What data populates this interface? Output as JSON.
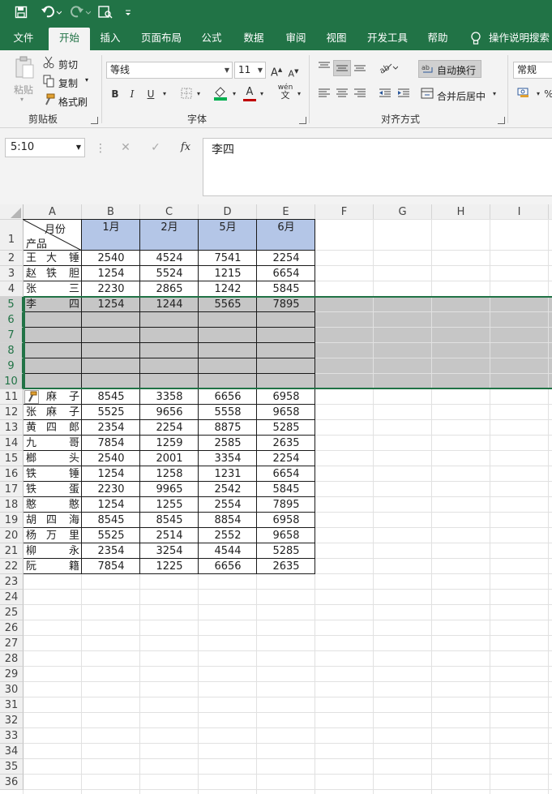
{
  "quick_access": {
    "save_icon": "save-icon",
    "undo_icon": "undo-icon",
    "redo_icon": "redo-icon",
    "preview_icon": "print-preview-icon",
    "more_icon": "customize-icon"
  },
  "tabs": [
    "文件",
    "开始",
    "插入",
    "页面布局",
    "公式",
    "数据",
    "审阅",
    "视图",
    "开发工具",
    "帮助"
  ],
  "tell_me": "操作说明搜索",
  "clipboard": {
    "paste": "粘贴",
    "cut": "剪切",
    "copy": "复制",
    "format_painter": "格式刷",
    "group": "剪贴板"
  },
  "font": {
    "name": "等线",
    "size": "11",
    "grow": "A",
    "shrink": "A",
    "bold": "B",
    "italic": "I",
    "underline": "U",
    "font_color": "A",
    "phonetic_top": "wén",
    "phonetic_bottom": "文",
    "group": "字体"
  },
  "alignment": {
    "wrap": "自动换行",
    "merge": "合并后居中",
    "group": "对齐方式"
  },
  "number": {
    "format": "常规"
  },
  "formula_bar": {
    "name_box": "5:10",
    "cancel": "✕",
    "enter": "✓",
    "fx": "fx",
    "content": "李四"
  },
  "columns": [
    "A",
    "B",
    "C",
    "D",
    "E",
    "F",
    "G",
    "H",
    "I"
  ],
  "rows": [
    "1",
    "2",
    "3",
    "4",
    "5",
    "6",
    "7",
    "8",
    "9",
    "10",
    "11",
    "12",
    "13",
    "14",
    "15",
    "16",
    "17",
    "18",
    "19",
    "20",
    "21",
    "22",
    "23",
    "24",
    "25",
    "26",
    "27",
    "28",
    "29",
    "30",
    "31",
    "32",
    "33",
    "34",
    "35",
    "36"
  ],
  "header_cell": {
    "top_right": "月份",
    "bottom_left": "产品"
  },
  "month_headers": [
    "1月",
    "2月",
    "5月",
    "6月"
  ],
  "name_col_width_chars": "",
  "table_rows": [
    {
      "row": "2",
      "name": [
        "王",
        "大",
        "锤"
      ],
      "values": [
        "2540",
        "4524",
        "7541",
        "2254"
      ]
    },
    {
      "row": "3",
      "name": [
        "赵",
        "铁",
        "胆"
      ],
      "values": [
        "1254",
        "5524",
        "1215",
        "6654"
      ]
    },
    {
      "row": "4",
      "name": [
        "张",
        "",
        "三"
      ],
      "values": [
        "2230",
        "2865",
        "1242",
        "5845"
      ]
    },
    {
      "row": "5",
      "name": [
        "李",
        "",
        "四"
      ],
      "values": [
        "1254",
        "1244",
        "5565",
        "7895"
      ]
    },
    {
      "row": "11",
      "name": [
        "",
        "麻",
        "子"
      ],
      "values": [
        "8545",
        "3358",
        "6656",
        "6958"
      ]
    },
    {
      "row": "12",
      "name": [
        "张",
        "麻",
        "子"
      ],
      "values": [
        "5525",
        "9656",
        "5558",
        "9658"
      ]
    },
    {
      "row": "13",
      "name": [
        "黄",
        "四",
        "郎"
      ],
      "values": [
        "2354",
        "2254",
        "8875",
        "5285"
      ]
    },
    {
      "row": "14",
      "name": [
        "九",
        "",
        "哥"
      ],
      "values": [
        "7854",
        "1259",
        "2585",
        "2635"
      ]
    },
    {
      "row": "15",
      "name": [
        "榔",
        "",
        "头"
      ],
      "values": [
        "2540",
        "2001",
        "3354",
        "2254"
      ]
    },
    {
      "row": "16",
      "name": [
        "铁",
        "",
        "锤"
      ],
      "values": [
        "1254",
        "1258",
        "1231",
        "6654"
      ]
    },
    {
      "row": "17",
      "name": [
        "铁",
        "",
        "蛋"
      ],
      "values": [
        "2230",
        "9965",
        "2542",
        "5845"
      ]
    },
    {
      "row": "18",
      "name": [
        "憨",
        "",
        "憨"
      ],
      "values": [
        "1254",
        "1255",
        "2554",
        "7895"
      ]
    },
    {
      "row": "19",
      "name": [
        "胡",
        "四",
        "海"
      ],
      "values": [
        "8545",
        "8545",
        "8854",
        "6958"
      ]
    },
    {
      "row": "20",
      "name": [
        "杨",
        "万",
        "里"
      ],
      "values": [
        "5525",
        "2514",
        "2552",
        "9658"
      ]
    },
    {
      "row": "21",
      "name": [
        "柳",
        "",
        "永"
      ],
      "values": [
        "2354",
        "3254",
        "4544",
        "5285"
      ]
    },
    {
      "row": "22",
      "name": [
        "阮",
        "",
        "籍"
      ],
      "values": [
        "7854",
        "1225",
        "6656",
        "2635"
      ]
    }
  ],
  "selected_rows": "5:10",
  "paste_options_icon": "paste-options-icon",
  "colors": {
    "excel_green": "#217346",
    "header_fill": "#b4c6e7",
    "selection_fill": "#c6c6c6",
    "selected_header_text": "#217346"
  }
}
